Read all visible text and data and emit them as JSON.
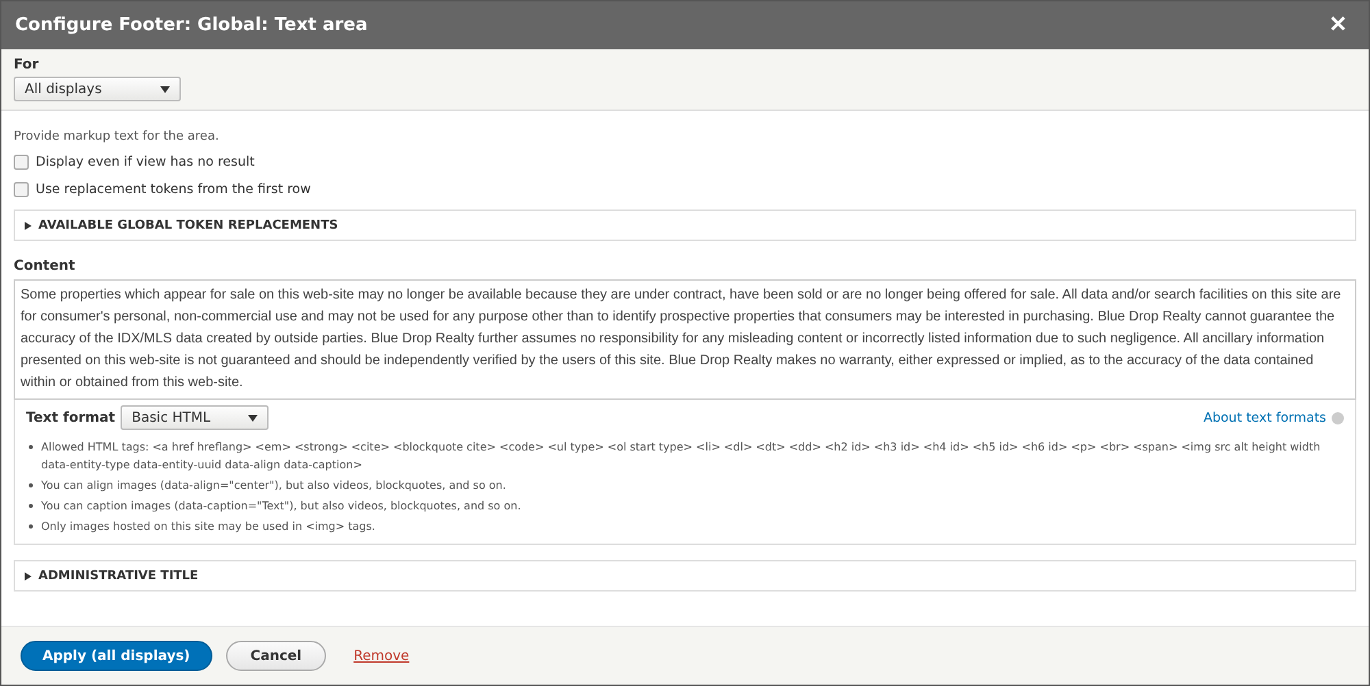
{
  "dialog": {
    "title": "Configure Footer: Global: Text area",
    "close": "✕"
  },
  "for": {
    "label": "For",
    "value": "All displays"
  },
  "description": "Provide markup text for the area.",
  "checkboxes": [
    {
      "label": "Display even if view has no result",
      "checked": false
    },
    {
      "label": "Use replacement tokens from the first row",
      "checked": false
    }
  ],
  "token_section": {
    "title": "AVAILABLE GLOBAL TOKEN REPLACEMENTS",
    "expanded": false
  },
  "content": {
    "label": "Content",
    "value": "Some properties which appear for sale on this web-site may no longer be available because they are under contract, have been sold or are no longer being offered for sale.  All data and/or search facilities on this site are for consumer's personal, non-commercial use and may not be used for any purpose other than to identify prospective properties that consumers may be interested in purchasing.  Blue Drop Realty cannot guarantee the accuracy of the IDX/MLS data created by outside parties. Blue Drop Realty further assumes no responsibility for any misleading content or incorrectly listed information due to such negligence.  All ancillary information presented on this web-site is not guaranteed and should be independently verified by the users of this site. Blue Drop Realty makes no warranty, either expressed or implied, as to the accuracy of the data contained within or obtained from this web-site."
  },
  "text_format": {
    "label": "Text format",
    "value": "Basic HTML",
    "help_link": "About text formats",
    "tips": [
      "Allowed HTML tags: <a href hreflang> <em> <strong> <cite> <blockquote cite> <code> <ul type> <ol start type> <li> <dl> <dt> <dd> <h2 id> <h3 id> <h4 id> <h5 id> <h6 id> <p> <br> <span> <img src alt height width data-entity-type data-entity-uuid data-align data-caption>",
      "You can align images (data-align=\"center\"), but also videos, blockquotes, and so on.",
      "You can caption images (data-caption=\"Text\"), but also videos, blockquotes, and so on.",
      "Only images hosted on this site may be used in <img> tags."
    ]
  },
  "admin_section": {
    "title": "ADMINISTRATIVE TITLE",
    "expanded": false
  },
  "buttons": [
    {
      "label": "Apply (all displays)",
      "kind": "primary"
    },
    {
      "label": "Cancel",
      "kind": "secondary"
    },
    {
      "label": "Remove",
      "kind": "link"
    }
  ]
}
